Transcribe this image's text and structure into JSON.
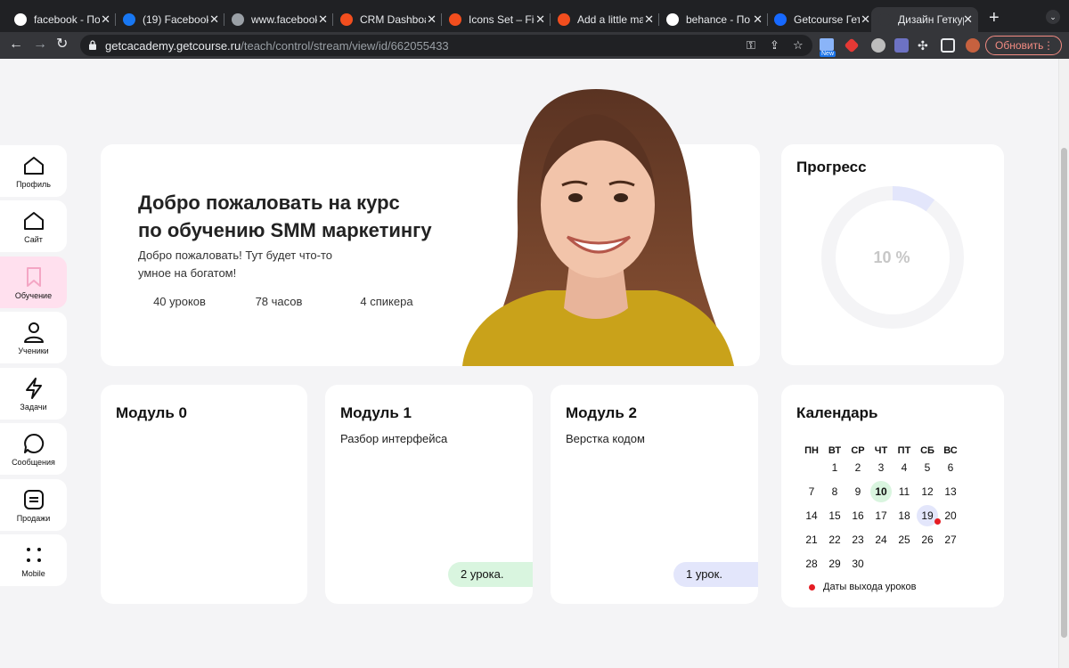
{
  "browser": {
    "tabs": [
      {
        "title": "facebook - По",
        "icon": "google-icon",
        "color": "#ffffff"
      },
      {
        "title": "(19) Facebook",
        "icon": "facebook-icon",
        "color": "#1877f2"
      },
      {
        "title": "www.facebook",
        "icon": "globe-icon",
        "color": "#9aa0a6"
      },
      {
        "title": "CRM Dashboa",
        "icon": "figma-icon",
        "color": "#f24e1e"
      },
      {
        "title": "Icons Set – Fig",
        "icon": "figma-icon",
        "color": "#f24e1e"
      },
      {
        "title": "Add a little ma",
        "icon": "figma-icon",
        "color": "#f24e1e"
      },
      {
        "title": "behance - По",
        "icon": "google-icon",
        "color": "#ffffff"
      },
      {
        "title": "Getcourse Гет",
        "icon": "behance-icon",
        "color": "#1769ff"
      },
      {
        "title": "Дизайн Геткур",
        "icon": "getcourse-icon",
        "color": "#35363a"
      }
    ],
    "url_host": "getcacademy.getcourse.ru",
    "url_path": "/teach/control/stream/view/id/662055433",
    "new_badge": "New",
    "update_button": "Обновить"
  },
  "sidebar": {
    "items": [
      {
        "label": "Профиль",
        "icon": "home-icon"
      },
      {
        "label": "Сайт",
        "icon": "home-icon"
      },
      {
        "label": "Обучение",
        "icon": "bookmark-icon"
      },
      {
        "label": "Ученики",
        "icon": "user-icon"
      },
      {
        "label": "Задачи",
        "icon": "lightning-icon"
      },
      {
        "label": "Сообщения",
        "icon": "message-icon"
      },
      {
        "label": "Продажи",
        "icon": "list-icon"
      },
      {
        "label": "Mobile",
        "icon": "dots-icon"
      }
    ]
  },
  "welcome": {
    "title_line1": "Добро пожаловать на курс",
    "title_line2": "по обучению SMM маркетингу",
    "subtitle_line1": "Добро пожаловать! Тут будет что-то",
    "subtitle_line2": "умное на богатом!",
    "pills": [
      {
        "label": "40 уроков",
        "color": "#ffd6ea"
      },
      {
        "label": "78 часов",
        "color": "#d9f5df"
      },
      {
        "label": "4 спикера",
        "color": "#e3e6fb"
      }
    ]
  },
  "progress": {
    "title": "Прогресс",
    "value_label": "10 %",
    "value": 0.1,
    "accent": "#e3e6fb"
  },
  "modules": [
    {
      "title": "Модуль 0",
      "desc": "",
      "badge": ""
    },
    {
      "title": "Модуль 1",
      "desc": "Разбор интерфейса",
      "badge": "2 урока.",
      "badge_color": "#d9f5df"
    },
    {
      "title": "Модуль 2",
      "desc": "Верстка кодом",
      "badge": "1 урок.",
      "badge_color": "#e3e6fb"
    }
  ],
  "calendar": {
    "title": "Календарь",
    "weekdays": [
      "ПН",
      "ВТ",
      "СР",
      "ЧТ",
      "ПТ",
      "СБ",
      "ВС"
    ],
    "days": [
      "1",
      "2",
      "3",
      "4",
      "5",
      "6",
      "7",
      "8",
      "9",
      "10",
      "11",
      "12",
      "13",
      "14",
      "15",
      "16",
      "17",
      "18",
      "19",
      "20",
      "21",
      "22",
      "23",
      "24",
      "25",
      "26",
      "27",
      "28",
      "29",
      "30"
    ],
    "today": "10",
    "release_dates": [
      "19"
    ],
    "legend": "Даты выхода уроков"
  }
}
